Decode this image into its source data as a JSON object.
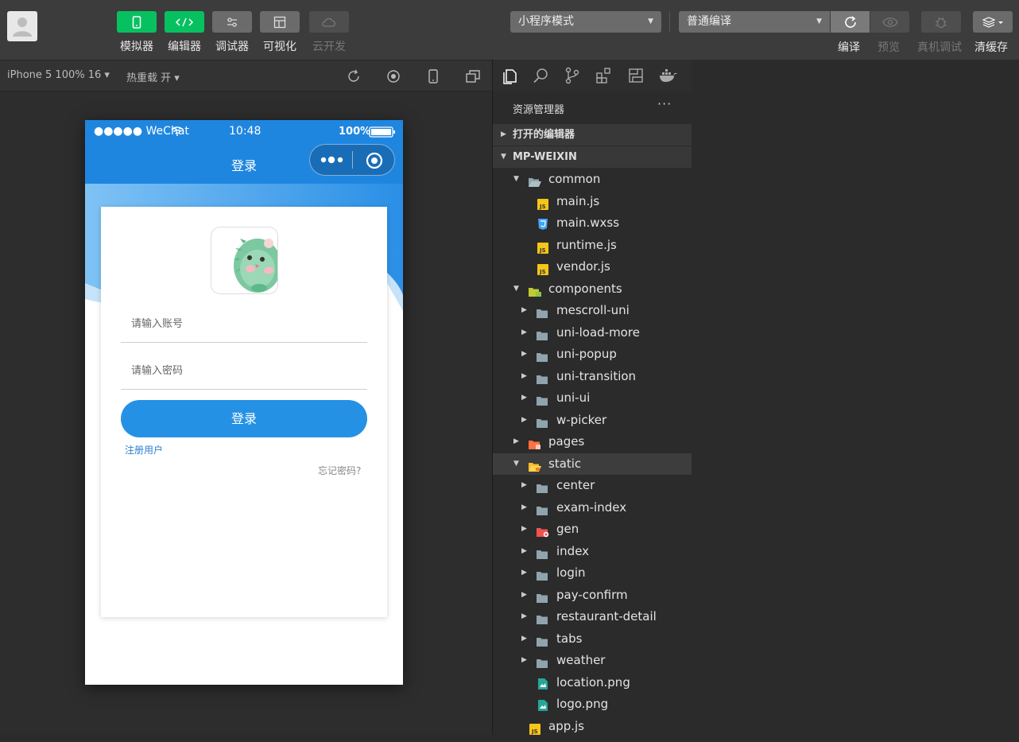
{
  "toolbar": {
    "buttons": [
      {
        "label": "模拟器"
      },
      {
        "label": "编辑器"
      },
      {
        "label": "调试器"
      },
      {
        "label": "可视化"
      },
      {
        "label": "云开发"
      }
    ],
    "mode_select": "小程序模式",
    "compile_select": "普通编译",
    "right_labels": {
      "compile": "编译",
      "preview": "预览",
      "remote_debug": "真机调试",
      "clear_cache": "清缓存"
    }
  },
  "simulator_bar": {
    "device": "iPhone 5 100% 16 ▾",
    "hot_reload": "热重载 开 ▾"
  },
  "phone": {
    "status": {
      "carrier": "●●●●● WeChat",
      "time": "10:48",
      "battery": "100%"
    },
    "nav_title": "登录",
    "account_placeholder": "请输入账号",
    "password_placeholder": "请输入密码",
    "login_button": "登录",
    "register_link": "注册用户",
    "forgot_link": "忘记密码?"
  },
  "explorer": {
    "title": "资源管理器",
    "more": "···",
    "open_editors": "打开的编辑器",
    "project": "MP-WEIXIN",
    "tree": [
      {
        "name": "common",
        "type": "folder-open",
        "level": 1,
        "expanded": true
      },
      {
        "name": "main.js",
        "type": "js",
        "level": 2
      },
      {
        "name": "main.wxss",
        "type": "css",
        "level": 2
      },
      {
        "name": "runtime.js",
        "type": "js",
        "level": 2
      },
      {
        "name": "vendor.js",
        "type": "js",
        "level": 2
      },
      {
        "name": "components",
        "type": "folder-components",
        "level": 1,
        "expanded": true
      },
      {
        "name": "mescroll-uni",
        "type": "folder",
        "level": 2
      },
      {
        "name": "uni-load-more",
        "type": "folder",
        "level": 2
      },
      {
        "name": "uni-popup",
        "type": "folder",
        "level": 2
      },
      {
        "name": "uni-transition",
        "type": "folder",
        "level": 2
      },
      {
        "name": "uni-ui",
        "type": "folder",
        "level": 2
      },
      {
        "name": "w-picker",
        "type": "folder",
        "level": 2
      },
      {
        "name": "pages",
        "type": "folder-pages",
        "level": 1,
        "expanded": false
      },
      {
        "name": "static",
        "type": "folder-static",
        "level": 1,
        "expanded": true,
        "selected": true
      },
      {
        "name": "center",
        "type": "folder",
        "level": 2
      },
      {
        "name": "exam-index",
        "type": "folder",
        "level": 2
      },
      {
        "name": "gen",
        "type": "folder-gen",
        "level": 2
      },
      {
        "name": "index",
        "type": "folder",
        "level": 2
      },
      {
        "name": "login",
        "type": "folder",
        "level": 2
      },
      {
        "name": "pay-confirm",
        "type": "folder",
        "level": 2
      },
      {
        "name": "restaurant-detail",
        "type": "folder",
        "level": 2
      },
      {
        "name": "tabs",
        "type": "folder",
        "level": 2
      },
      {
        "name": "weather",
        "type": "folder",
        "level": 2
      },
      {
        "name": "location.png",
        "type": "image",
        "level": 2
      },
      {
        "name": "logo.png",
        "type": "image",
        "level": 2
      },
      {
        "name": "app.js",
        "type": "js",
        "level": 1
      }
    ]
  },
  "colors": {
    "accent_green": "#07c160",
    "wechat_blue": "#1f86e0",
    "login_blue": "#2591e4"
  }
}
